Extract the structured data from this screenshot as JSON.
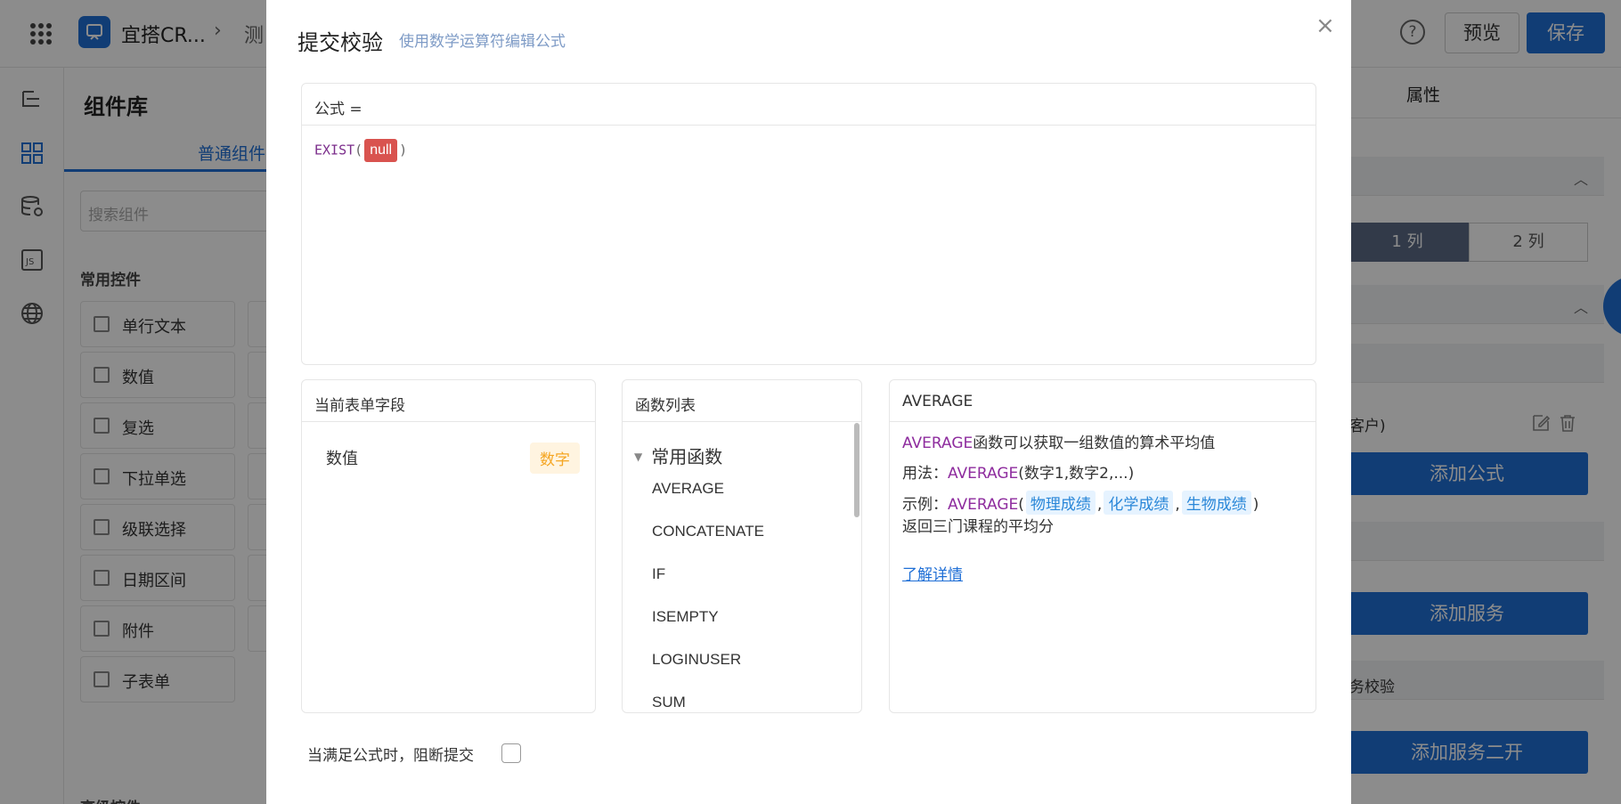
{
  "topbar": {
    "app_name": "宜搭CR...",
    "crumb_sep": "›",
    "crumb_next": "测",
    "help": "?",
    "preview_label": "预览",
    "save_label": "保存"
  },
  "library": {
    "title": "组件库",
    "tab": "普通组件",
    "search_placeholder": "搜索组件",
    "section_common": "常用控件",
    "items": [
      "单行文本",
      "数值",
      "复选",
      "下拉单选",
      "级联选择",
      "日期区间",
      "附件",
      "子表单"
    ],
    "section_advanced": "高级控件"
  },
  "props": {
    "tab": "属性",
    "seg_1": "1 列",
    "seg_2": "2 列",
    "customer_text": "客户)",
    "add_formula": "添加公式",
    "add_service": "添加服务",
    "service_check": "务校验",
    "add_service_2": "添加服务二开"
  },
  "modal": {
    "title": "提交校验",
    "subtitle": "使用数学运算符编辑公式",
    "close": "×",
    "formula_label": "公式 =",
    "formula": {
      "fn": "EXIST",
      "open": "(",
      "arg": "null",
      "close": ")"
    },
    "fields_panel": {
      "title": "当前表单字段",
      "field_name": "数值",
      "field_type": "数字"
    },
    "funcs_panel": {
      "title": "函数列表",
      "group": "常用函数",
      "items": [
        "AVERAGE",
        "CONCATENATE",
        "IF",
        "ISEMPTY",
        "LOGINUSER",
        "SUM"
      ]
    },
    "detail_panel": {
      "title": "AVERAGE",
      "desc_fn": "AVERAGE",
      "desc_rest": "函数可以获取一组数值的算术平均值",
      "usage_label": "用法：",
      "usage_fn": "AVERAGE",
      "usage_args": "(数字1,数字2,...)",
      "example_label": "示例：",
      "example_fn": "AVERAGE",
      "example_open": "(",
      "example_arg1": "物理成绩",
      "example_sep1": ",",
      "example_arg2": "化学成绩",
      "example_sep2": ",",
      "example_arg3": "生物成绩",
      "example_close": ")",
      "example_result": "返回三门课程的平均分",
      "learn_more": "了解详情"
    },
    "block_label": "当满足公式时，阻断提交",
    "block_checked": false
  },
  "colors": {
    "primary": "#1f6fd6",
    "null_tag": "#d9534f",
    "function_purple": "#8e2c9e",
    "number_tag": "#f5a623"
  }
}
